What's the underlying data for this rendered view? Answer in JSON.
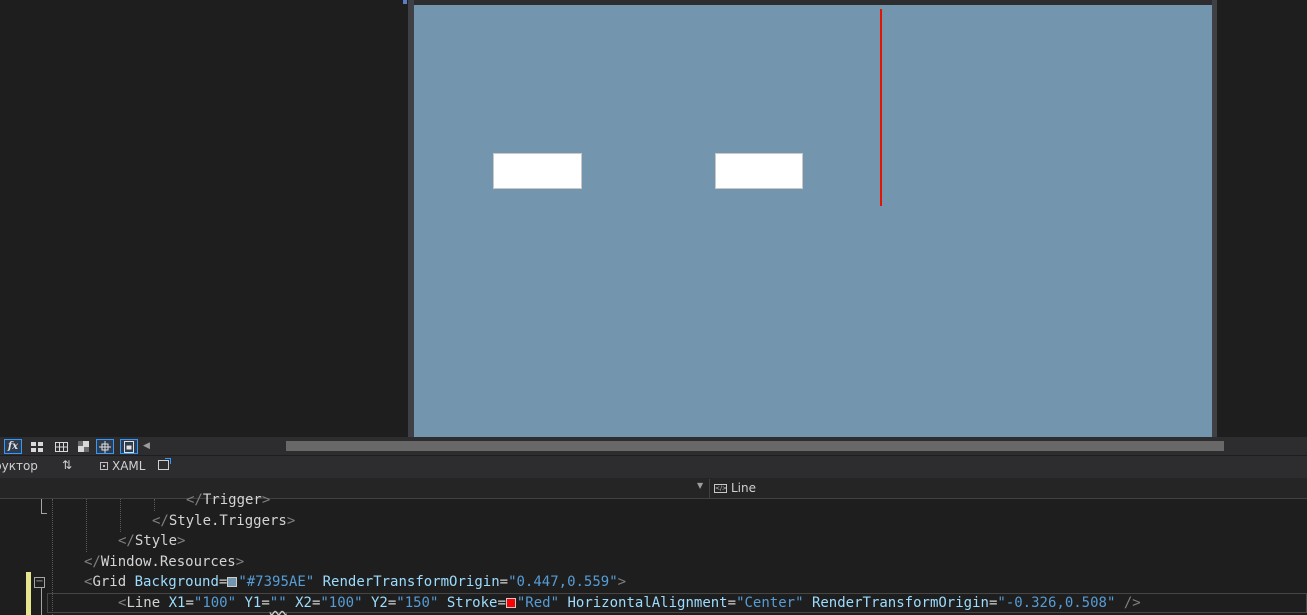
{
  "designer": {
    "artboard_background": "#7395AE",
    "line_stroke": "#E51400"
  },
  "toolbar": {
    "fx_label": "fx",
    "buttons": [
      "formula-icon",
      "grid-icon",
      "snap-grid-icon",
      "artboard-background-icon",
      "snap-lines-icon",
      "effects-icon"
    ]
  },
  "tabs": {
    "design_label": "руктор",
    "swap_icon": "⇅",
    "xaml_label": "XAML"
  },
  "nav": {
    "left_value": "",
    "right_value": "Line"
  },
  "code": {
    "lines": [
      {
        "tag_open": "</",
        "tag": "Trigger",
        "tag_close": ">"
      },
      {
        "tag_open": "</",
        "tag": "Style.Triggers",
        "tag_close": ">"
      },
      {
        "tag_open": "</",
        "tag": "Style",
        "tag_close": ">"
      },
      {
        "tag_open": "</",
        "tag": "Window.Resources",
        "tag_close": ">"
      },
      {
        "tag_open": "<",
        "tag": "Grid",
        "tag_close": ">",
        "attrs": [
          {
            "name": "Background",
            "value": "\"#7395AE\"",
            "swatch": "#7395AE"
          },
          {
            "name": "RenderTransformOrigin",
            "value": "\"0.447,0.559\""
          }
        ]
      },
      {
        "tag_open": "<",
        "tag": "Line",
        "tag_close": " />",
        "attrs": [
          {
            "name": "X1",
            "value": "\"100\""
          },
          {
            "name": "Y1",
            "value": "\"\""
          },
          {
            "name": "X2",
            "value": "\"100\""
          },
          {
            "name": "Y2",
            "value": "\"150\""
          },
          {
            "name": "Stroke",
            "value": "\"Red\"",
            "swatch": "#FF0000"
          },
          {
            "name": "HorizontalAlignment",
            "value": "\"Center\""
          },
          {
            "name": "RenderTransformOrigin",
            "value": "\"-0.326,0.508\""
          }
        ]
      }
    ]
  }
}
